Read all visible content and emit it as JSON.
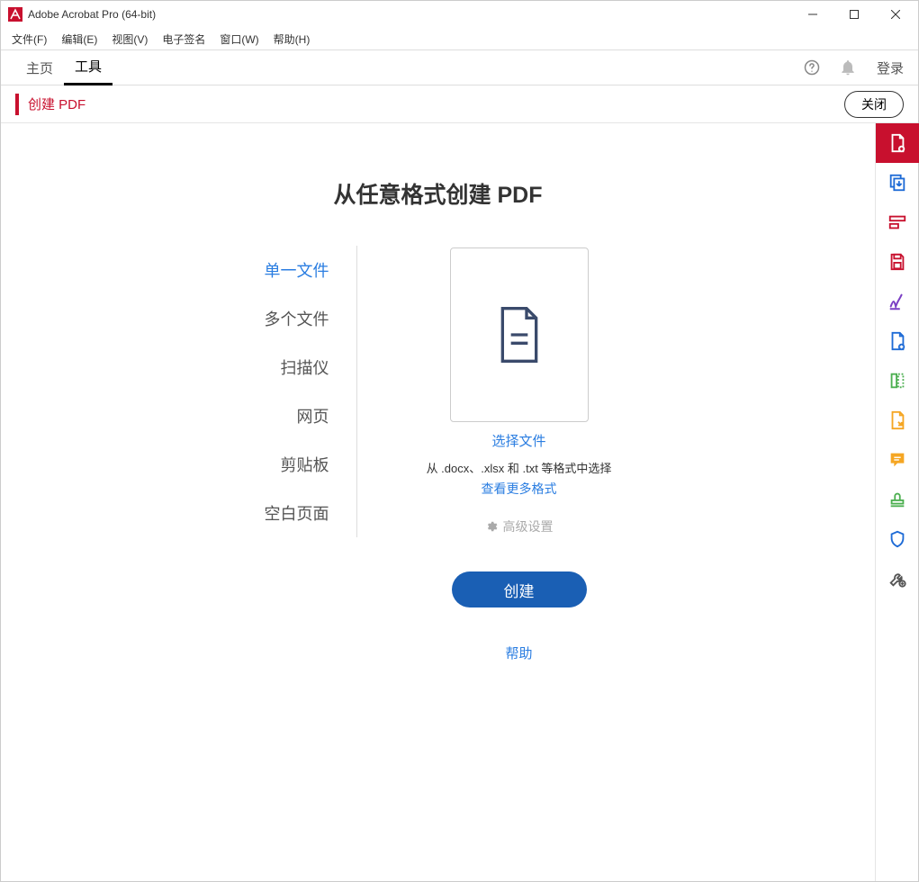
{
  "window": {
    "title": "Adobe Acrobat Pro (64-bit)"
  },
  "menu": {
    "file": "文件(F)",
    "edit": "编辑(E)",
    "view": "视图(V)",
    "esign": "电子签名",
    "window": "窗口(W)",
    "help": "帮助(H)"
  },
  "tabs": {
    "home": "主页",
    "tools": "工具",
    "login": "登录"
  },
  "toolheader": {
    "name": "创建 PDF",
    "close": "关闭"
  },
  "main": {
    "heading": "从任意格式创建 PDF",
    "sidelist": {
      "single": "单一文件",
      "multiple": "多个文件",
      "scanner": "扫描仪",
      "webpage": "网页",
      "clipboard": "剪贴板",
      "blank": "空白页面"
    },
    "center": {
      "selectfile": "选择文件",
      "formats": "从 .docx、.xlsx 和 .txt 等格式中选择",
      "moreformats": "查看更多格式",
      "advanced": "高级设置",
      "create": "创建",
      "help": "帮助"
    }
  },
  "rail": {
    "items": [
      "create-pdf",
      "combine",
      "edit",
      "save",
      "sign",
      "export",
      "organize",
      "export-pdf",
      "comment",
      "stamp",
      "protect",
      "more-tools"
    ]
  }
}
